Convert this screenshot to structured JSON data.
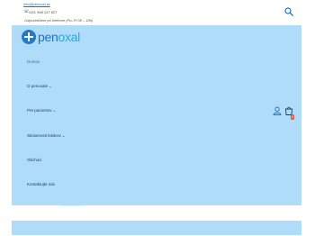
{
  "topbar": {
    "email": "info@penoxal.sk",
    "phone_icon": "phone-icon",
    "phone": "+421 948 127 627",
    "hours": "Odpoveďáme pri telefone (Po–Pi 08 – 18h)",
    "search_icon": "search-icon"
  },
  "logo": {
    "part1": "pen",
    "part2": "oxal"
  },
  "nav": {
    "items": [
      {
        "label": "Domov",
        "has_submenu": false
      },
      {
        "label": "O penoxale",
        "has_submenu": true
      },
      {
        "label": "Pre pacientov",
        "has_submenu": true
      },
      {
        "label": "Skúsenosti lekárov",
        "has_submenu": true
      },
      {
        "label": "Obchod",
        "has_submenu": false
      },
      {
        "label": "Kontaktujte nás",
        "has_submenu": false
      }
    ],
    "chevron": "⌄"
  },
  "cart": {
    "count": "0",
    "user_icon": "user-icon",
    "cart_icon": "cart-icon"
  },
  "colors": {
    "brand_blue": "#1e73be",
    "brand_light": "#2aa8e0",
    "menu_bg": "#aedcf9",
    "badge": "#e94e3b"
  }
}
